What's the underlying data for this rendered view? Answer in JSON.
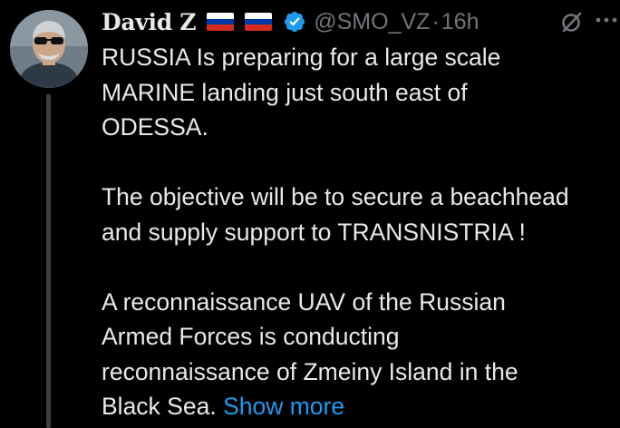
{
  "author": {
    "display_name": "David Z",
    "handle": "@SMO_VZ",
    "separator": "·",
    "timestamp": "16h",
    "flags": [
      "russia-flag",
      "russia-flag"
    ],
    "verified": true
  },
  "tweet": {
    "paragraphs": [
      [
        "RUSSIA Is preparing for a large scale",
        "MARINE landing just south east of",
        "ODESSA."
      ],
      [
        "The objective will be to secure a beachhead",
        "and supply support to TRANSNISTRIA  !"
      ],
      [
        "A reconnaissance UAV of the Russian",
        "Armed Forces is conducting",
        "reconnaissance of Zmeiny Island in the"
      ]
    ],
    "last_line": "Black Sea.",
    "show_more_label": "Show more"
  },
  "icons": {
    "grok": "grok-icon",
    "more": "more-icon",
    "verified": "verified-badge-icon"
  },
  "colors": {
    "background": "#000000",
    "text": "#e7e9ea",
    "secondary": "#71767b",
    "accent": "#1d9bf0",
    "thread_line": "#3b3f44"
  }
}
